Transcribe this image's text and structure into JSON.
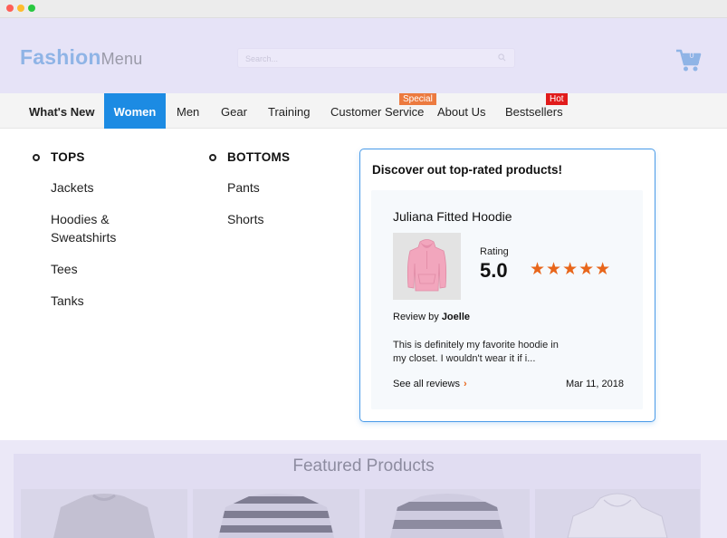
{
  "header": {
    "logo_bold": "Fashion",
    "logo_light": "Menu",
    "search_placeholder": "Search...",
    "cart_count": "0"
  },
  "nav": {
    "items": [
      {
        "label": "What's New"
      },
      {
        "label": "Women",
        "active": true
      },
      {
        "label": "Men"
      },
      {
        "label": "Gear"
      },
      {
        "label": "Training"
      },
      {
        "label": "Customer Service",
        "tag": "Special"
      },
      {
        "label": "About Us"
      },
      {
        "label": "Bestsellers",
        "tag": "Hot"
      }
    ]
  },
  "menu": {
    "tops": {
      "heading": "TOPS",
      "links": [
        "Jackets",
        "Hoodies & Sweatshirts",
        "Tees",
        "Tanks"
      ]
    },
    "bottoms": {
      "heading": "BOTTOMS",
      "links": [
        "Pants",
        "Shorts"
      ]
    },
    "promo": {
      "title": "Discover out top-rated products!",
      "product_name": "Juliana Fitted Hoodie",
      "rating_label": "Rating",
      "rating_value": "5.0",
      "stars": "★★★★★",
      "review_by_prefix": "Review by",
      "reviewer": "Joelle",
      "review_text": "This is definitely my favorite hoodie in my closet. I wouldn't wear it if i...",
      "see_all": "See all reviews",
      "date": "Mar 11, 2018"
    }
  },
  "featured": {
    "title": "Featured Products"
  },
  "colors": {
    "accent": "#1c8be3",
    "header_bg": "#e6e3f7",
    "star": "#e8661b",
    "special_tag": "#ec7a3f",
    "hot_tag": "#e11b1b",
    "promo_border": "#4a9be8"
  }
}
